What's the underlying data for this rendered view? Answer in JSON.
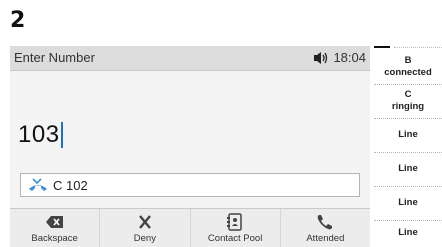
{
  "step": "2",
  "screen": {
    "title": "Enter Number",
    "time": "18:04",
    "speaker_icon": "speaker-volume-icon",
    "number": "103",
    "suggestion": {
      "icon": "missed-call-icon",
      "text": "C 102"
    }
  },
  "softkeys": [
    {
      "label": "Backspace",
      "icon": "backspace-icon"
    },
    {
      "label": "Deny",
      "icon": "close-icon"
    },
    {
      "label": "Contact Pool",
      "icon": "contact-book-icon"
    },
    {
      "label": "Attended",
      "icon": "phone-handset-icon"
    }
  ],
  "lines": [
    {
      "name": "B",
      "status": "connected"
    },
    {
      "name": "C",
      "status": "ringing"
    },
    {
      "name": "Line",
      "status": ""
    },
    {
      "name": "Line",
      "status": ""
    },
    {
      "name": "Line",
      "status": ""
    },
    {
      "name": "Line",
      "status": ""
    }
  ],
  "colors": {
    "caret": "#1a6fd0",
    "missed_call_icon": "#3a8fd6"
  }
}
